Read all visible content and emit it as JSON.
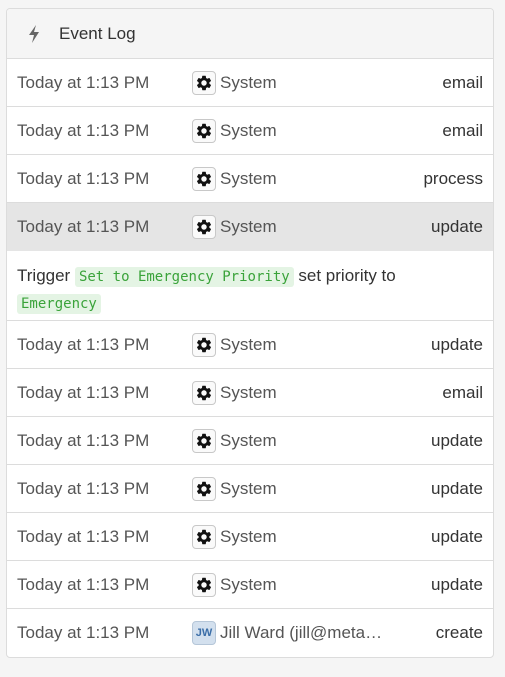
{
  "panel": {
    "title": "Event Log",
    "icon": "bolt-icon"
  },
  "rows_top": [
    {
      "time": "Today at 1:13 PM",
      "actor": "System",
      "actor_icon": "gear-icon",
      "action": "email"
    },
    {
      "time": "Today at 1:13 PM",
      "actor": "System",
      "actor_icon": "gear-icon",
      "action": "email"
    },
    {
      "time": "Today at 1:13 PM",
      "actor": "System",
      "actor_icon": "gear-icon",
      "action": "process"
    },
    {
      "time": "Today at 1:13 PM",
      "actor": "System",
      "actor_icon": "gear-icon",
      "action": "update",
      "selected": true
    }
  ],
  "detail": {
    "prefix": "Trigger",
    "trigger_name": "Set to Emergency Priority",
    "middle": "set priority to",
    "value": "Emergency"
  },
  "rows_bottom": [
    {
      "time": "Today at 1:13 PM",
      "actor": "System",
      "actor_icon": "gear-icon",
      "action": "update"
    },
    {
      "time": "Today at 1:13 PM",
      "actor": "System",
      "actor_icon": "gear-icon",
      "action": "email"
    },
    {
      "time": "Today at 1:13 PM",
      "actor": "System",
      "actor_icon": "gear-icon",
      "action": "update"
    },
    {
      "time": "Today at 1:13 PM",
      "actor": "System",
      "actor_icon": "gear-icon",
      "action": "update"
    },
    {
      "time": "Today at 1:13 PM",
      "actor": "System",
      "actor_icon": "gear-icon",
      "action": "update"
    },
    {
      "time": "Today at 1:13 PM",
      "actor": "System",
      "actor_icon": "gear-icon",
      "action": "update"
    },
    {
      "time": "Today at 1:13 PM",
      "actor": "Jill Ward (jill@meta…",
      "actor_icon": "avatar-initials",
      "initials": "JW",
      "action": "create"
    }
  ],
  "colors": {
    "selected_row": "#e5e5e5",
    "code_text": "#3aa33a",
    "code_bg": "#e4f4e4",
    "avatar_bg": "#d3e0ee"
  }
}
